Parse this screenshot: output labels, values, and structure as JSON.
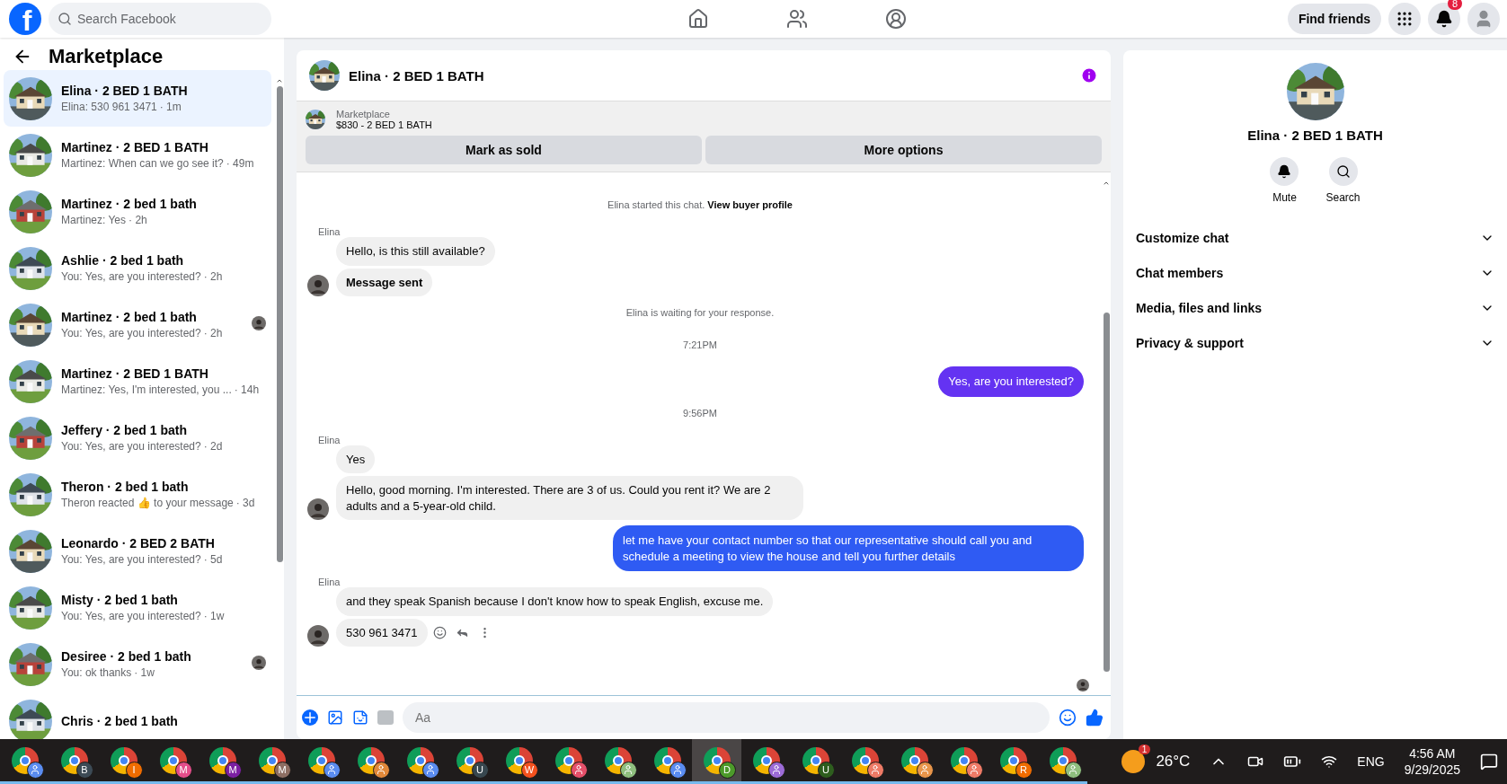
{
  "topbar": {
    "logo": "f",
    "search": {
      "placeholder": "Search Facebook"
    },
    "find_friends": "Find friends",
    "notifications_badge": "8"
  },
  "sidebar": {
    "title": "Marketplace",
    "conversations": [
      {
        "title": "Elina · 2 BED 1 BATH",
        "preview": "Elina: 530 961 3471",
        "time": "· 1m",
        "selected": true,
        "seen": false
      },
      {
        "title": "Martinez · 2 BED 1 BATH",
        "preview": "Martinez: When can we go see it?",
        "time": "· 49m",
        "selected": false,
        "seen": false
      },
      {
        "title": "Martinez · 2 bed 1 bath",
        "preview": "Martinez: Yes",
        "time": "· 2h",
        "selected": false,
        "seen": false
      },
      {
        "title": "Ashlie · 2 bed 1 bath",
        "preview": "You: Yes, are you interested?",
        "time": "· 2h",
        "selected": false,
        "seen": false
      },
      {
        "title": "Martinez · 2 bed 1 bath",
        "preview": "You: Yes, are you interested?",
        "time": "· 2h",
        "selected": false,
        "seen": true
      },
      {
        "title": "Martinez · 2 BED 1 BATH",
        "preview": "Martinez: Yes, I'm interested, you ...",
        "time": "· 14h",
        "selected": false,
        "seen": false
      },
      {
        "title": "Jeffery · 2 bed 1 bath",
        "preview": "You: Yes, are you interested?",
        "time": "· 2d",
        "selected": false,
        "seen": false
      },
      {
        "title": "Theron · 2 bed 1 bath",
        "preview": "Theron reacted 👍 to your message",
        "time": "· 3d",
        "selected": false,
        "seen": false
      },
      {
        "title": "Leonardo · 2 BED 2 BATH",
        "preview": "You: Yes, are you interested?",
        "time": "· 5d",
        "selected": false,
        "seen": false
      },
      {
        "title": "Misty · 2 bed 1 bath",
        "preview": "You: Yes, are you interested?",
        "time": "· 1w",
        "selected": false,
        "seen": false
      },
      {
        "title": "Desiree · 2 bed 1 bath",
        "preview": "You: ok thanks",
        "time": "· 1w",
        "selected": false,
        "seen": true
      },
      {
        "title": "Chris · 2 bed 1 bath",
        "selected": false,
        "seen": false
      }
    ]
  },
  "chat": {
    "title": "Elina · 2 BED 1 BATH",
    "listing": {
      "label": "Marketplace",
      "name": "$830 - 2 BED 1 BATH"
    },
    "buttons": [
      "Mark as sold",
      "More options"
    ],
    "messages": [
      {
        "kind": "notice",
        "text": "Elina started this chat.",
        "link": "View buyer profile"
      },
      {
        "kind": "incoming",
        "sender": "Elina",
        "bubbles": [
          {
            "text": "Hello, is this still available?",
            "bold": false
          },
          {
            "text": "Message sent",
            "bold": true
          }
        ],
        "actions": false
      },
      {
        "kind": "notice",
        "text": "Elina is waiting for your response."
      },
      {
        "kind": "time",
        "text": "7:21PM"
      },
      {
        "kind": "outgoing",
        "text": "Yes, are you interested?",
        "color": "#6433f2"
      },
      {
        "kind": "time",
        "text": "9:56PM"
      },
      {
        "kind": "incoming",
        "sender": "Elina",
        "bubbles": [
          {
            "text": "Yes",
            "bold": false
          },
          {
            "text": "Hello, good morning. I'm interested. There are 3 of us. Could you rent it? We are 2 adults and a 5-year-old child.",
            "bold": false
          }
        ],
        "actions": false
      },
      {
        "kind": "outgoing",
        "text": "let me have your contact number so that our representative should call you and schedule a meeting to view the house and tell you further details",
        "color": "#2f5bf3"
      },
      {
        "kind": "incoming",
        "sender": "Elina",
        "bubbles": [
          {
            "text": "and they speak Spanish because I don't know how to speak English, excuse me.",
            "bold": false
          },
          {
            "text": "530 961 3471",
            "bold": false
          }
        ],
        "actions": true
      }
    ],
    "composer": {
      "placeholder": "Aa"
    }
  },
  "details": {
    "title": "Elina · 2 BED 1 BATH",
    "actions": [
      "Mute",
      "Search"
    ],
    "sections": [
      "Customize chat",
      "Chat members",
      "Media, files and links",
      "Privacy & support"
    ]
  },
  "taskbar": {
    "apps": [
      {
        "color": "#5a8cf0",
        "selected": false
      },
      {
        "badge": "B",
        "color": "#3c4a55",
        "selected": false
      },
      {
        "badge": "I",
        "color": "#ef6c00",
        "selected": false
      },
      {
        "badge": "M",
        "color": "#e44d8a",
        "selected": false
      },
      {
        "badge": "M",
        "color": "#7b1fa2",
        "selected": false
      },
      {
        "badge": "M",
        "color": "#8d6e63",
        "selected": false
      },
      {
        "color": "#5a8cf0",
        "selected": false
      },
      {
        "color": "#e0883a",
        "selected": false
      },
      {
        "color": "#5a8cf0",
        "selected": false
      },
      {
        "badge": "U",
        "color": "#37474f",
        "selected": false
      },
      {
        "badge": "W",
        "color": "#f4511e",
        "selected": false
      },
      {
        "color": "#e5506a",
        "selected": false
      },
      {
        "color": "#8fbf7f",
        "selected": false
      },
      {
        "color": "#5a8cf0",
        "selected": false
      },
      {
        "badge": "D",
        "color": "#4c9a2a",
        "selected": true
      },
      {
        "color": "#9c6bd6",
        "selected": false
      },
      {
        "badge": "U",
        "color": "#2e5e1e",
        "selected": false
      },
      {
        "color": "#ee7a66",
        "selected": false
      },
      {
        "color": "#e8954a",
        "selected": false
      },
      {
        "color": "#ee7a66",
        "selected": false
      },
      {
        "badge": "R",
        "color": "#ef6c00",
        "selected": false
      },
      {
        "color": "#8fbf7f",
        "selected": false
      }
    ],
    "weather_badge": "1",
    "temperature": "26°C",
    "language": "ENG",
    "time": "4:56 AM",
    "date": "9/29/2025"
  }
}
